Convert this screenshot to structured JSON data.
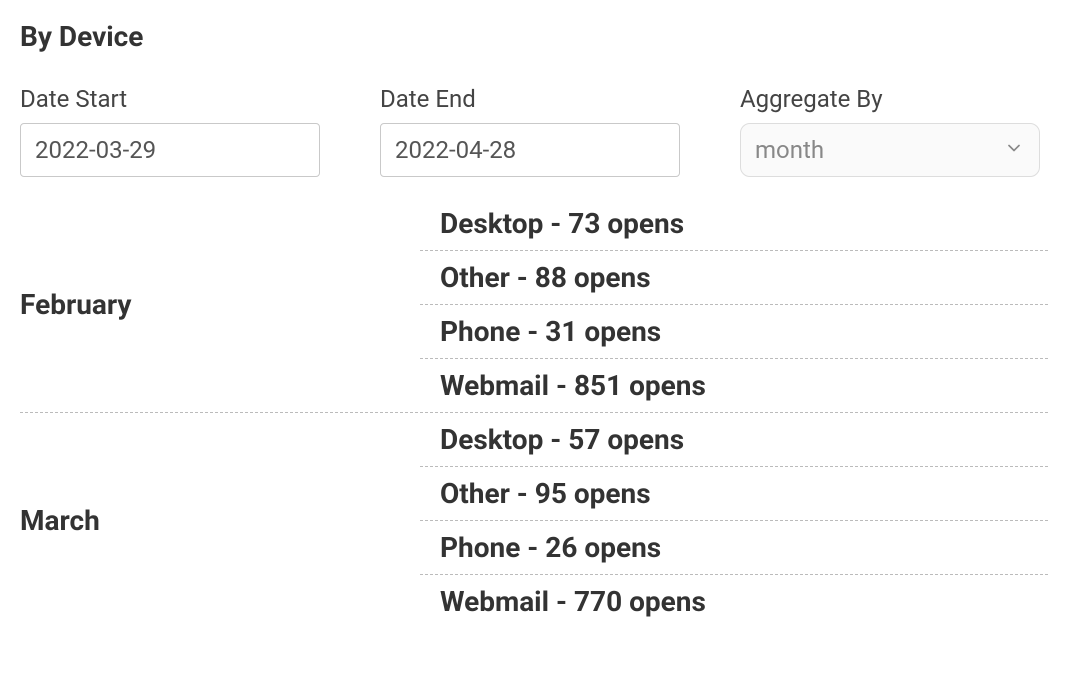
{
  "title": "By Device",
  "controls": {
    "date_start": {
      "label": "Date Start",
      "value": "2022-03-29"
    },
    "date_end": {
      "label": "Date End",
      "value": "2022-04-28"
    },
    "aggregate_by": {
      "label": "Aggregate By",
      "value": "month"
    }
  },
  "results": [
    {
      "month": "February",
      "rows": [
        "Desktop - 73 opens",
        "Other - 88 opens",
        "Phone - 31 opens",
        "Webmail - 851 opens"
      ]
    },
    {
      "month": "March",
      "rows": [
        "Desktop - 57 opens",
        "Other - 95 opens",
        "Phone - 26 opens",
        "Webmail - 770 opens"
      ]
    }
  ]
}
